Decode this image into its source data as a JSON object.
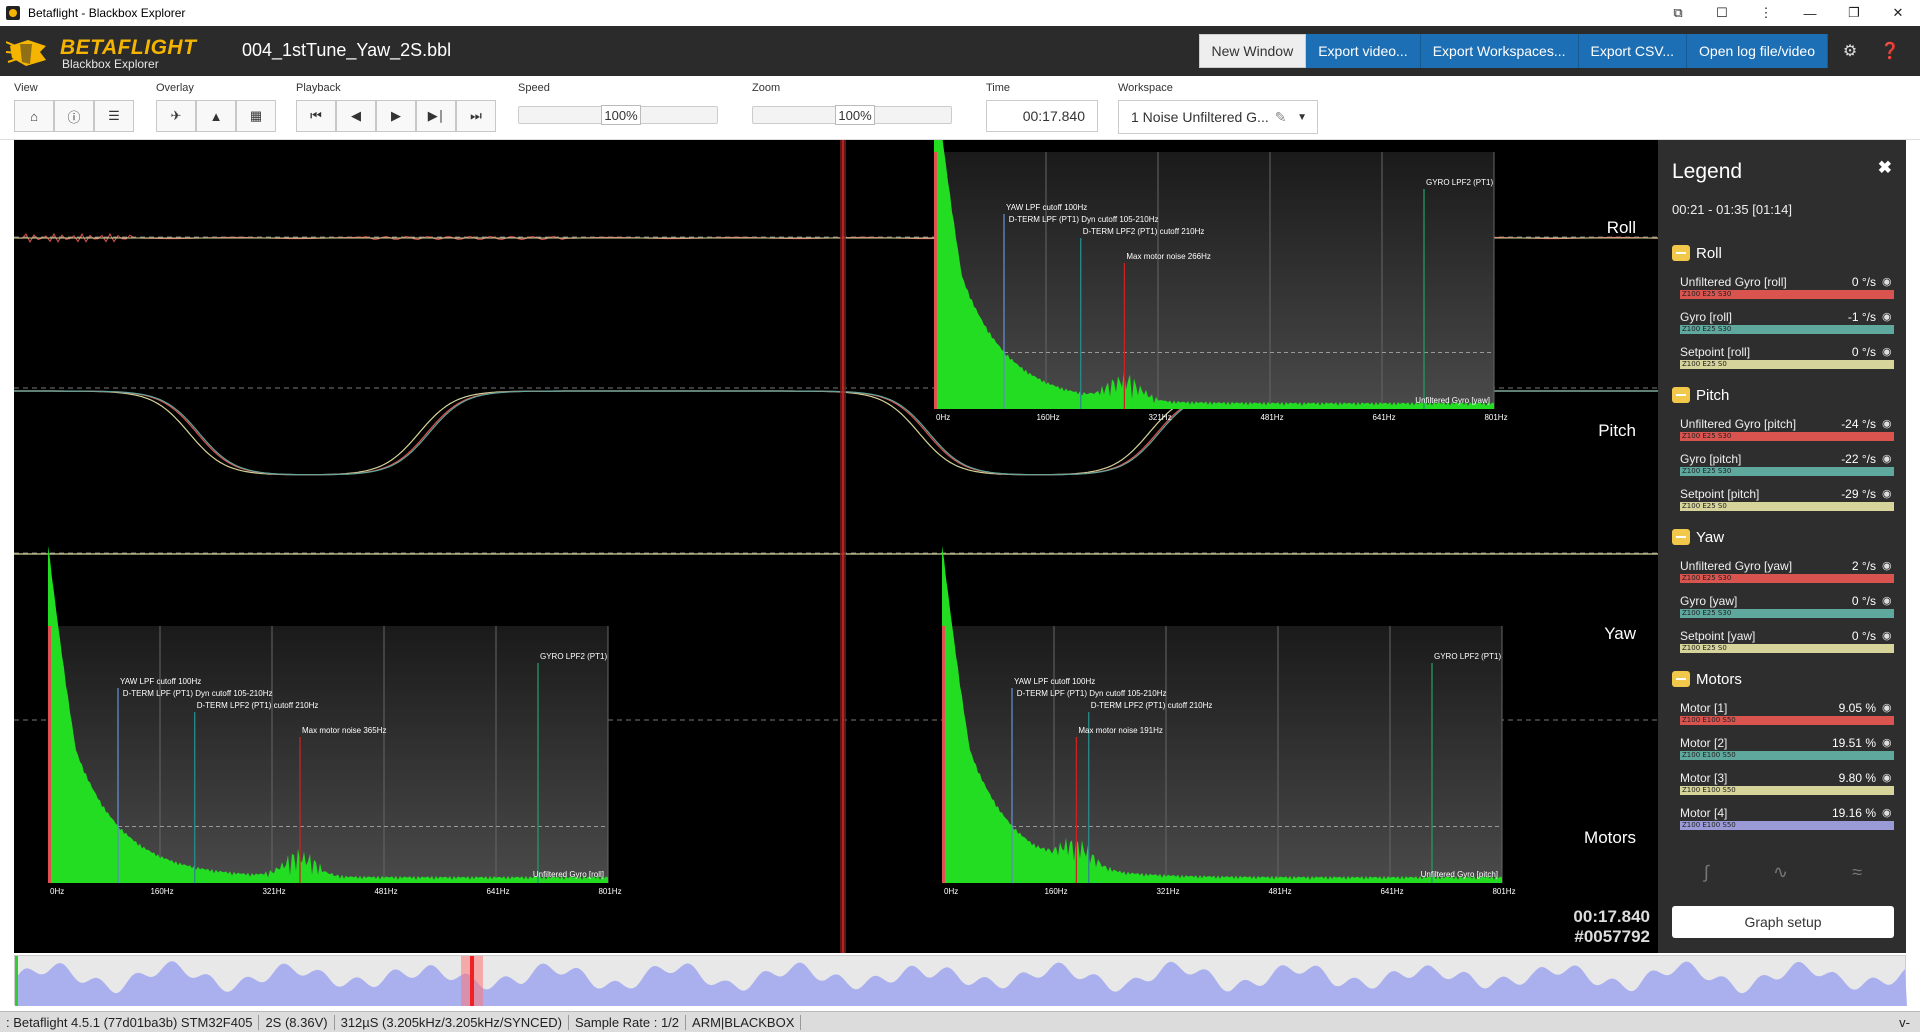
{
  "window": {
    "title": "Betaflight - Blackbox Explorer",
    "controls": [
      "⧉",
      "☐",
      "⋮",
      "—",
      "❐",
      "✕"
    ]
  },
  "header": {
    "brand": "BETAFLIGHT",
    "brand_sub": "Blackbox Explorer",
    "file_name": "004_1stTune_Yaw_2S.bbl",
    "buttons": [
      "New Window",
      "Export video...",
      "Export Workspaces...",
      "Export CSV...",
      "Open log file/video"
    ],
    "icons": [
      "gear-icon",
      "help-icon"
    ]
  },
  "toolbar": {
    "view_label": "View",
    "overlay_label": "Overlay",
    "playback_label": "Playback",
    "speed_label": "Speed",
    "speed_value": "100%",
    "zoom_label": "Zoom",
    "zoom_value": "100%",
    "time_label": "Time",
    "time_value": "00:17.840",
    "workspace_label": "Workspace",
    "workspace_value": "1 Noise Unfiltered G..."
  },
  "graph": {
    "axis_labels": [
      "Roll",
      "Pitch",
      "Yaw",
      "Motors"
    ],
    "time": "00:17.840",
    "frame": "#0057792",
    "spectra": [
      {
        "name": "yaw",
        "x_ticks": [
          "0Hz",
          "160Hz",
          "321Hz",
          "481Hz",
          "641Hz",
          "801Hz"
        ],
        "markers": [
          "YAW LPF cutoff 100Hz",
          "D-TERM LPF (PT1) Dyn cutoff 105-210Hz",
          "D-TERM LPF2 (PT1) cutoff 210Hz",
          "Max motor noise 266Hz",
          "GYRO LPF2 (PT1)"
        ],
        "source": "Unfiltered Gyro [yaw]"
      },
      {
        "name": "roll",
        "x_ticks": [
          "0Hz",
          "160Hz",
          "321Hz",
          "481Hz",
          "641Hz",
          "801Hz"
        ],
        "markers": [
          "YAW LPF cutoff 100Hz",
          "D-TERM LPF (PT1) Dyn cutoff 105-210Hz",
          "D-TERM LPF2 (PT1) cutoff 210Hz",
          "Max motor noise 365Hz",
          "GYRO LPF2 (PT1)"
        ],
        "source": "Unfiltered Gyro [roll]"
      },
      {
        "name": "pitch",
        "x_ticks": [
          "0Hz",
          "160Hz",
          "321Hz",
          "481Hz",
          "641Hz",
          "801Hz"
        ],
        "markers": [
          "YAW LPF cutoff 100Hz",
          "D-TERM LPF (PT1) Dyn cutoff 105-210Hz",
          "D-TERM LPF2 (PT1) cutoff 210Hz",
          "Max motor noise 191Hz",
          "GYRO LPF2 (PT1)"
        ],
        "source": "Unfiltered Gyro [pitch]"
      }
    ]
  },
  "legend": {
    "title": "Legend",
    "close": "✖",
    "range": "00:21 - 01:35 [01:14]",
    "groups": [
      {
        "name": "Roll",
        "items": [
          {
            "name": "Unfiltered Gyro [roll]",
            "value": "0 °/s",
            "scale": "Z100 E25 S30",
            "color": "#d9534f"
          },
          {
            "name": "Gyro [roll]",
            "value": "-1 °/s",
            "scale": "Z100 E25 S30",
            "color": "#5fa89e"
          },
          {
            "name": "Setpoint [roll]",
            "value": "0 °/s",
            "scale": "Z100 E25 S0",
            "color": "#d6d49a"
          }
        ]
      },
      {
        "name": "Pitch",
        "items": [
          {
            "name": "Unfiltered Gyro [pitch]",
            "value": "-24 °/s",
            "scale": "Z100 E25 S30",
            "color": "#d9534f"
          },
          {
            "name": "Gyro [pitch]",
            "value": "-22 °/s",
            "scale": "Z100 E25 S30",
            "color": "#5fa89e"
          },
          {
            "name": "Setpoint [pitch]",
            "value": "-29 °/s",
            "scale": "Z100 E25 S0",
            "color": "#d6d49a"
          }
        ]
      },
      {
        "name": "Yaw",
        "items": [
          {
            "name": "Unfiltered Gyro [yaw]",
            "value": "2 °/s",
            "scale": "Z100 E25 S30",
            "color": "#d9534f"
          },
          {
            "name": "Gyro [yaw]",
            "value": "0 °/s",
            "scale": "Z100 E25 S30",
            "color": "#5fa89e"
          },
          {
            "name": "Setpoint [yaw]",
            "value": "0 °/s",
            "scale": "Z100 E25 S0",
            "color": "#d6d49a"
          }
        ]
      },
      {
        "name": "Motors",
        "items": [
          {
            "name": "Motor [1]",
            "value": "9.05 %",
            "scale": "Z100 E100 S50",
            "color": "#d9534f"
          },
          {
            "name": "Motor [2]",
            "value": "19.51 %",
            "scale": "Z100 E100 S50",
            "color": "#5fa89e"
          },
          {
            "name": "Motor [3]",
            "value": "9.80 %",
            "scale": "Z100 E100 S50",
            "color": "#d6d49a"
          },
          {
            "name": "Motor [4]",
            "value": "19.16 %",
            "scale": "Z100 E100 S50",
            "color": "#9a9ad6"
          }
        ]
      }
    ],
    "graph_setup": "Graph setup"
  },
  "status": {
    "items": [
      ": Betaflight 4.5.1 (77d01ba3b) STM32F405",
      "2S (8.36V)",
      "312µS (3.205kHz/3.205kHz/SYNCED)",
      "Sample Rate : 1/2",
      "ARM|BLACKBOX"
    ],
    "version": "v-"
  }
}
